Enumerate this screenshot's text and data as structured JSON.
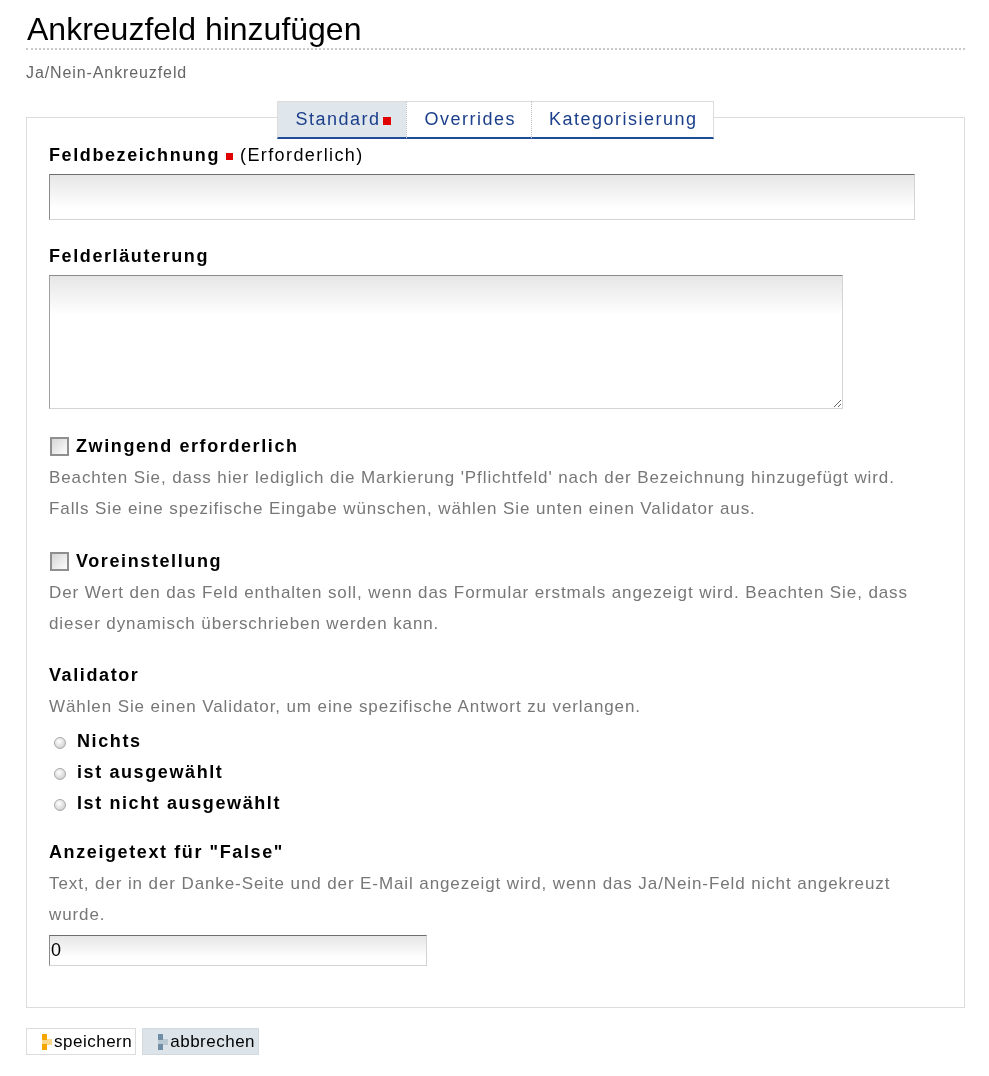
{
  "header": {
    "title": "Ankreuzfeld hinzufügen",
    "subtitle": "Ja/Nein-Ankreuzfeld"
  },
  "tabs": [
    {
      "label": "Standard",
      "selected": true,
      "required": true
    },
    {
      "label": "Overrides",
      "selected": false,
      "required": false
    },
    {
      "label": "Kategorisierung",
      "selected": false,
      "required": false
    }
  ],
  "fields": [
    {
      "kind": "text",
      "label": "Feldbezeichnung",
      "required": true,
      "required_note": "(Erforderlich)"
    },
    {
      "kind": "textarea",
      "label": "Felderläuterung",
      "required": false
    },
    {
      "kind": "checkbox",
      "label": "Zwingend erforderlich",
      "checked": false,
      "help": "Beachten Sie, dass hier lediglich die Markierung 'Pflichtfeld' nach der Bezeichnung hinzugefügt wird. Falls Sie eine spezifische Eingabe wünschen, wählen Sie unten einen Validator aus."
    },
    {
      "kind": "checkbox",
      "label": "Voreinstellung",
      "checked": false,
      "help": "Der Wert den das Feld enthalten soll, wenn das Formular erstmals angezeigt wird. Beachten Sie, dass dieser dynamisch überschrieben werden kann."
    },
    {
      "kind": "radio",
      "label": "Validator",
      "help": "Wählen Sie einen Validator, um eine spezifische Antwort zu verlangen.",
      "options": [
        {
          "label": "Nichts",
          "selected": false
        },
        {
          "label": "ist ausgewählt",
          "selected": false
        },
        {
          "label": "Ist nicht ausgewählt",
          "selected": false
        }
      ]
    },
    {
      "kind": "short_text",
      "label": "Anzeigetext für \"False\"",
      "required": false,
      "help": "Text, der in der Danke-Seite und der E-Mail angezeigt wird, wenn das Ja/Nein-Feld nicht angekreuzt wurde.",
      "value": "0"
    }
  ],
  "buttons": [
    {
      "kind": "save",
      "label": "speichern"
    },
    {
      "kind": "cancel",
      "label": "abbrechen"
    }
  ]
}
